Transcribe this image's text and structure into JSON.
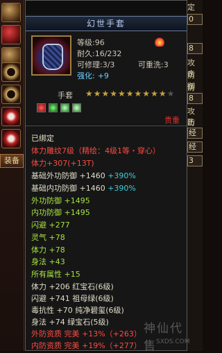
{
  "left_panel": {
    "slots": [
      "helmet-icon",
      "armor-icon",
      "ring-icon",
      "ring-icon",
      "ring-icon",
      "cloud-icon",
      "cloud-icon"
    ],
    "equip_tab": "装备"
  },
  "right_panel": {
    "labels": [
      "定力",
      "攻击",
      "防御",
      "防御",
      "攻击",
      "防御",
      "经",
      "经"
    ],
    "boxes": [
      "0",
      "8",
      "8",
      "3"
    ]
  },
  "tooltip": {
    "title": "幻世手套",
    "level": "等级:96",
    "durability": "耐久:16/232",
    "repairable": "可修理:3/3",
    "rewash": "可重洗:3",
    "strengthen_label": "强化:",
    "strengthen_value": "+9",
    "item_type": "手套",
    "stars_filled": "★★★★★★★★★★",
    "stars_empty": "★",
    "price": "贵重",
    "bound": "已绑定",
    "lines": [
      {
        "text": "体力雕纹7级（精绘：4级1等・穿心）",
        "color": "red"
      },
      {
        "text": "体力+307(+13T)",
        "color": "red"
      },
      {
        "text": "基础外功防御 +1460",
        "extra": "+390%",
        "color": "white"
      },
      {
        "text": "基础内功防御 +1460",
        "extra": "+390%",
        "color": "white"
      },
      {
        "text": "外功防御 +1495",
        "color": "green"
      },
      {
        "text": "内功防御 +1495",
        "color": "green"
      },
      {
        "text": "闪避 +277",
        "color": "green"
      },
      {
        "text": "灵气 +78",
        "color": "green"
      },
      {
        "text": "体力 +78",
        "color": "green"
      },
      {
        "text": "身法 +43",
        "color": "green"
      },
      {
        "text": "所有属性 +15",
        "color": "green"
      },
      {
        "text": "体力 +206 红宝石(6级)",
        "color": "white"
      },
      {
        "text": "闪避 +741 祖母绿(6级)",
        "color": "white"
      },
      {
        "text": "毒抗性 +70 纯净碧玺(6级)",
        "color": "white"
      },
      {
        "text": "身法 +74 绿宝石(5级)",
        "color": "white"
      },
      {
        "text": "外防资质  完美 +13%（+263）",
        "color": "red"
      },
      {
        "text": "内防资质  完美 +19%（+277）",
        "color": "red"
      }
    ]
  },
  "watermark": {
    "text": "神仙代售",
    "url": "SXDS.COM"
  }
}
